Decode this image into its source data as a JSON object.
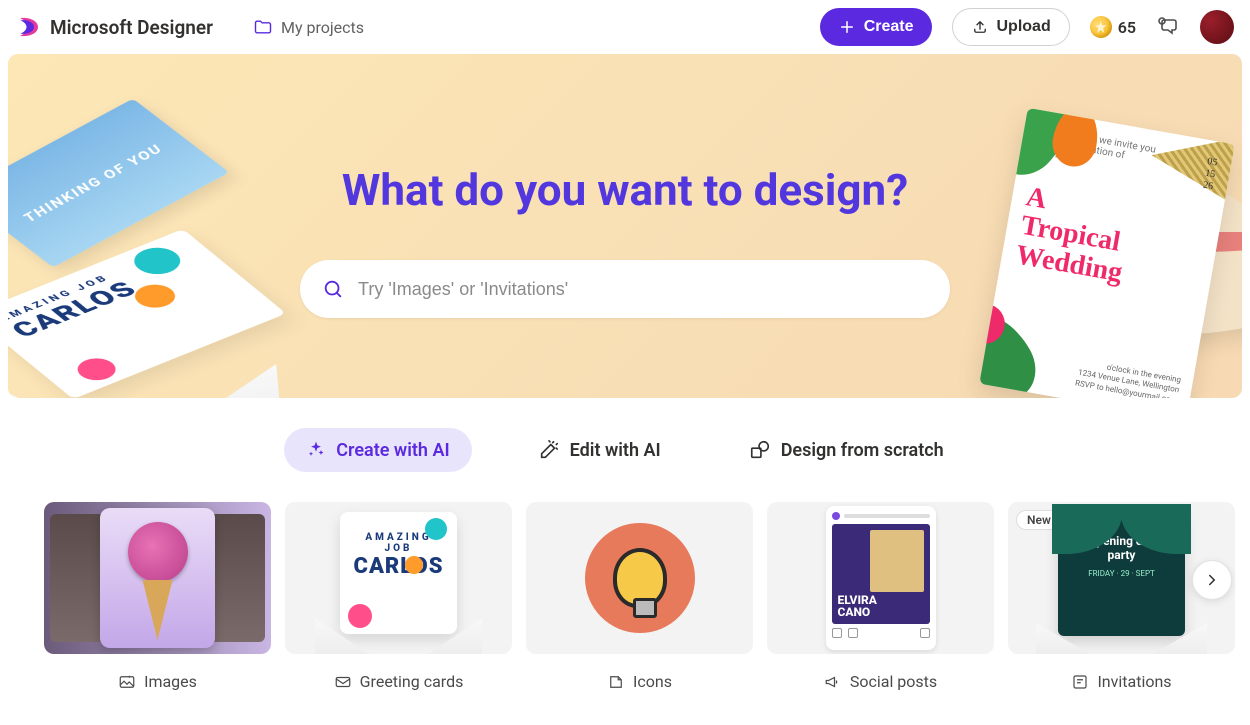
{
  "header": {
    "app_name": "Microsoft Designer",
    "my_projects": "My projects",
    "create_label": "Create",
    "upload_label": "Upload",
    "coin_count": "65"
  },
  "hero": {
    "title": "What do you want to design?",
    "search_placeholder": "Try 'Images' or 'Invitations'",
    "deco": {
      "skywrite": "THINKING OF YOU",
      "amazing_line1": "AMAZING JOB",
      "amazing_line2": "CARLOS",
      "wedding_line1": "A",
      "wedding_line2": "Tropical",
      "wedding_line3": "Wedding",
      "wedding_date1": "05",
      "wedding_date2": "15",
      "wedding_date3": "26"
    }
  },
  "modes": {
    "create_ai": "Create with AI",
    "edit_ai": "Edit with AI",
    "scratch": "Design from scratch"
  },
  "cards": {
    "new_badge": "New",
    "items": [
      {
        "label": "Images"
      },
      {
        "label": "Greeting cards",
        "line1": "AMAZING JOB",
        "line2": "CARLOS"
      },
      {
        "label": "Icons"
      },
      {
        "label": "Social posts",
        "name1": "ELVIRA",
        "name2": "CANO"
      },
      {
        "label": "Invitations",
        "inv_l1": "Opening day",
        "inv_l2": "party",
        "inv_day": "29"
      }
    ]
  }
}
